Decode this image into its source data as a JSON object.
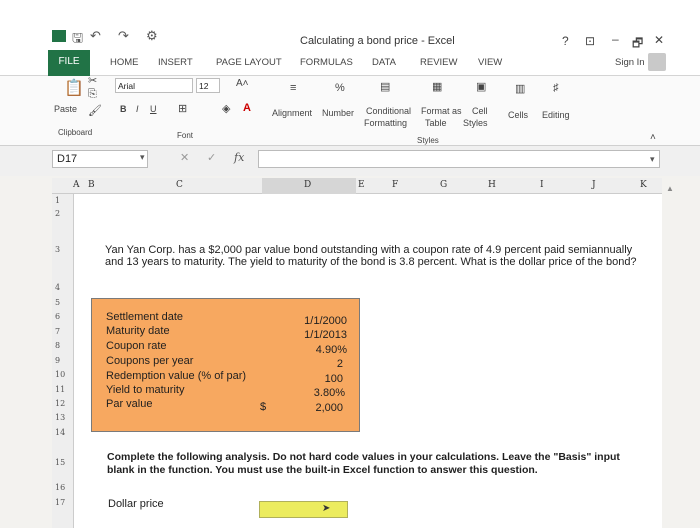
{
  "title": "Calculating a bond price - Excel",
  "window": {
    "help": "?",
    "minimize": "–",
    "maximize": "🗗",
    "close": "✕",
    "sign_in": "Sign In"
  },
  "tabs": [
    "FILE",
    "HOME",
    "INSERT",
    "PAGE LAYOUT",
    "FORMULAS",
    "DATA",
    "REVIEW",
    "VIEW"
  ],
  "ribbon": {
    "paste": "Paste",
    "clipboard": "Clipboard",
    "font_name": "Arial",
    "font_size": "12",
    "font_group": "Font",
    "alignment": "Alignment",
    "number": "Number",
    "percent": "%",
    "conditional": "Conditional",
    "formatting": "Formatting",
    "format_as": "Format as",
    "table": "Table",
    "cell": "Cell",
    "styles_btn": "Styles",
    "styles_group": "Styles",
    "cells": "Cells",
    "editing": "Editing",
    "bold": "B",
    "italic": "I",
    "underline": "U"
  },
  "formula_bar": {
    "name_box": "D17",
    "fx": "fx"
  },
  "columns": [
    "A",
    "B",
    "C",
    "D",
    "E",
    "F",
    "G",
    "H",
    "I",
    "J",
    "K"
  ],
  "rows": [
    "1",
    "2",
    "3",
    "4",
    "5",
    "6",
    "7",
    "8",
    "9",
    "10",
    "11",
    "12",
    "13",
    "14",
    "15",
    "16",
    "17"
  ],
  "problem_text": "Yan Yan Corp. has a $2,000 par value bond outstanding with a coupon rate of 4.9 percent paid semiannually and 13 years to maturity. The yield to maturity of the bond is 3.8 percent. What is the dollar price of the bond?",
  "inputs": {
    "labels": [
      "Settlement date",
      "Maturity date",
      "Coupon rate",
      "Coupons per year",
      "Redemption value (% of par)",
      "Yield to maturity",
      "Par value"
    ],
    "values": [
      "1/1/2000",
      "1/1/2013",
      "4.90%",
      "2",
      "100",
      "3.80%",
      "2,000"
    ],
    "currency": "$"
  },
  "instructions": "Complete the following analysis. Do not hard code values in your calculations. Leave the \"Basis\" input blank in the function. You must use the built-in Excel function to answer this question.",
  "answer_label": "Dollar price"
}
